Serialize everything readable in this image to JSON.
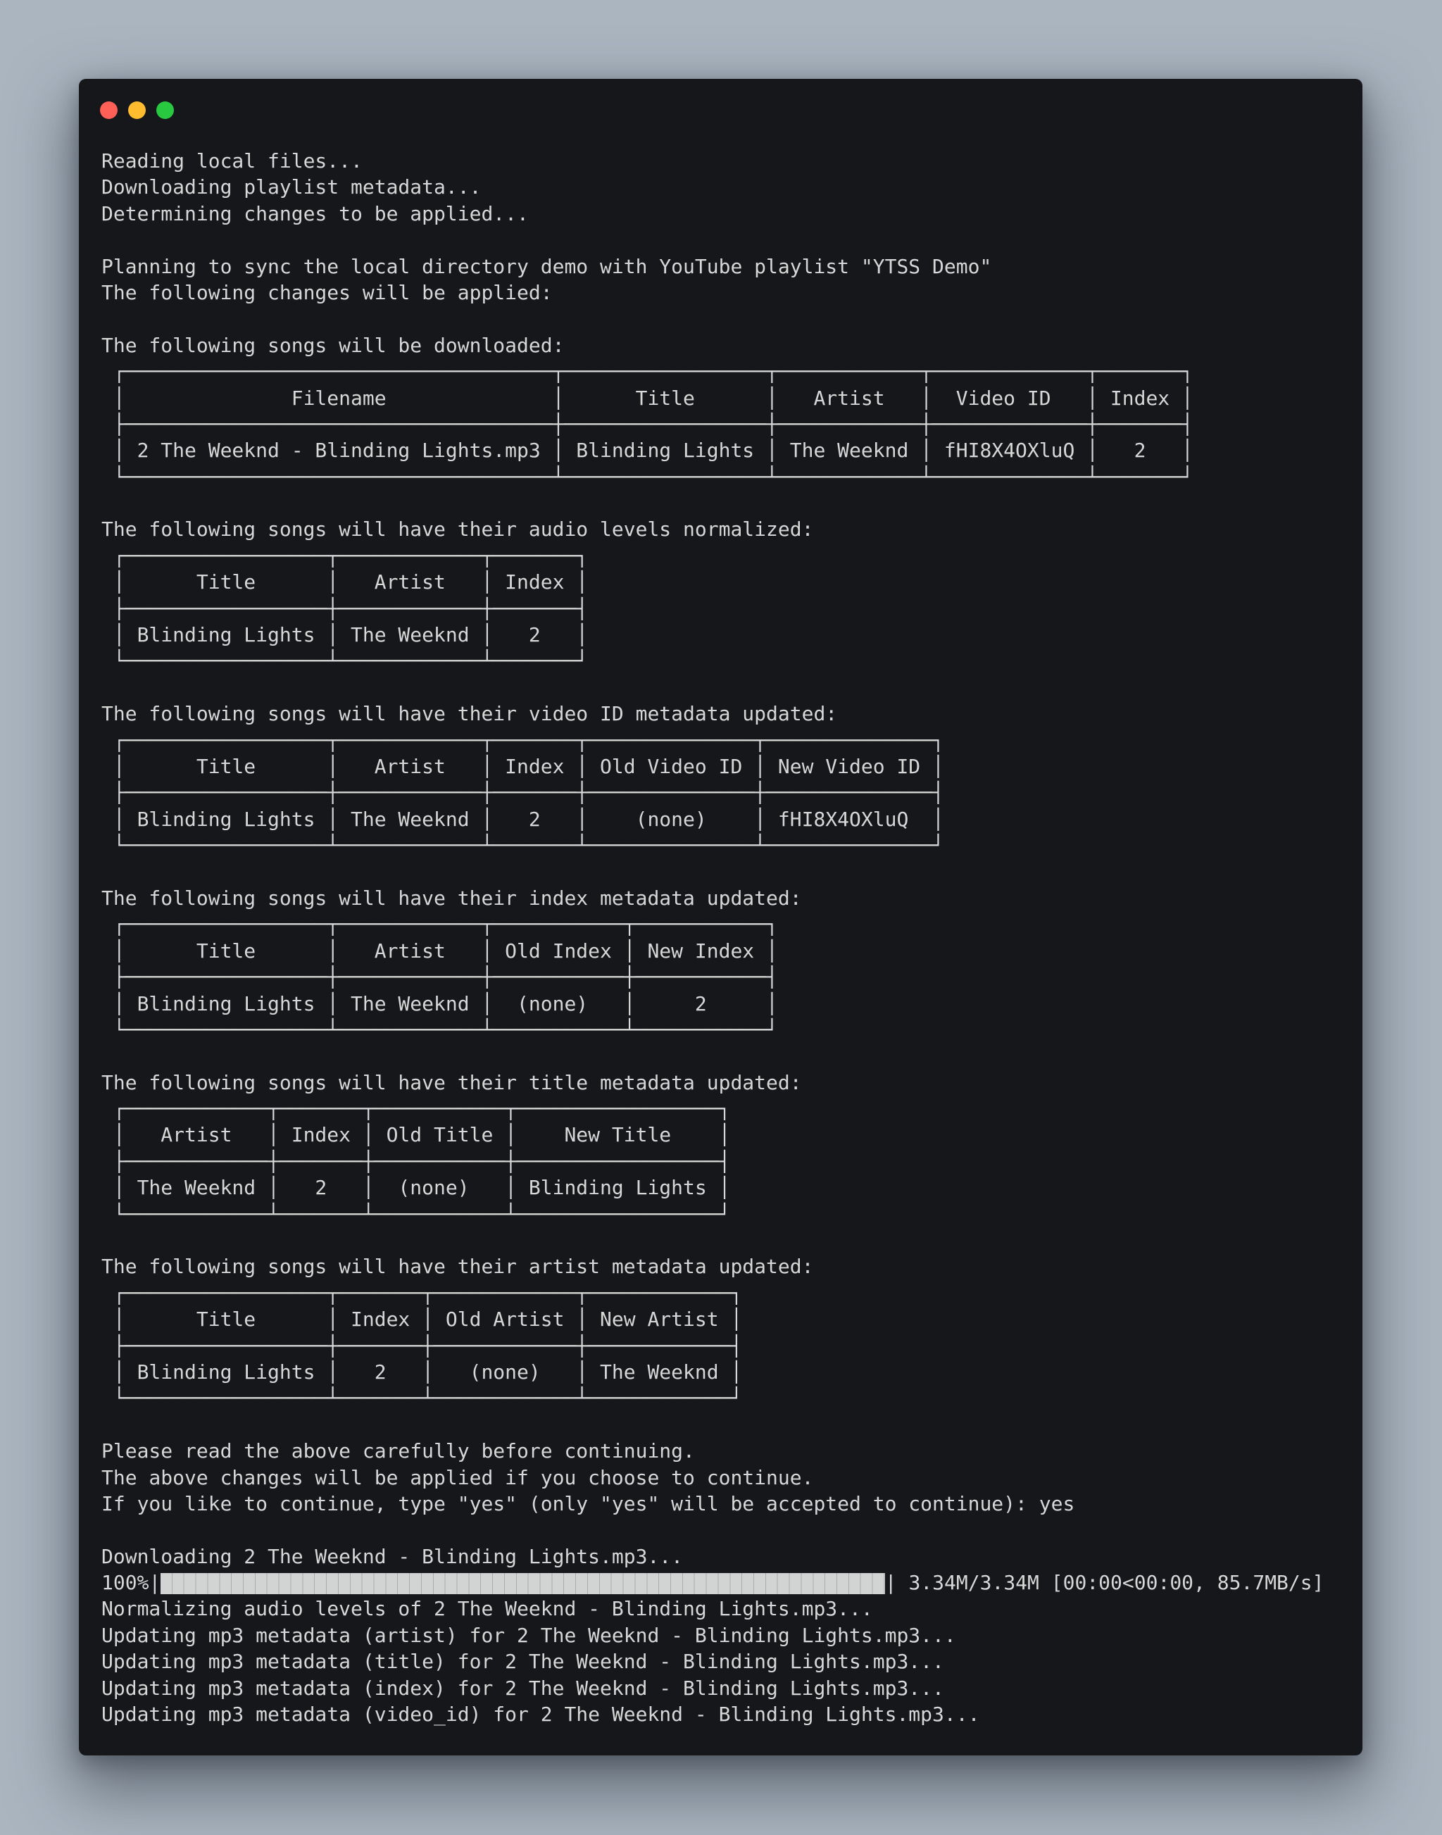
{
  "window": {
    "controls": [
      {
        "name": "close",
        "color": "#fe5f57"
      },
      {
        "name": "minimize",
        "color": "#febc2e"
      },
      {
        "name": "maximize",
        "color": "#28c840"
      }
    ]
  },
  "terminal": {
    "intro_lines": [
      "Reading local files...",
      "Downloading playlist metadata...",
      "Determining changes to be applied...",
      "",
      "Planning to sync the local directory demo with YouTube playlist \"YTSS Demo\"",
      "The following changes will be applied:",
      ""
    ],
    "sections": [
      {
        "heading": "The following songs will be downloaded:",
        "table": {
          "headers": [
            "Filename",
            "Title",
            "Artist",
            "Video ID",
            "Index"
          ],
          "rows": [
            [
              "2 The Weeknd - Blinding Lights.mp3",
              "Blinding Lights",
              "The Weeknd",
              "fHI8X4OXluQ",
              "2"
            ]
          ]
        }
      },
      {
        "heading": "The following songs will have their audio levels normalized:",
        "table": {
          "headers": [
            "Title",
            "Artist",
            "Index"
          ],
          "rows": [
            [
              "Blinding Lights",
              "The Weeknd",
              "2"
            ]
          ]
        }
      },
      {
        "heading": "The following songs will have their video ID metadata updated:",
        "table": {
          "headers": [
            "Title",
            "Artist",
            "Index",
            "Old Video ID",
            "New Video ID"
          ],
          "rows": [
            [
              "Blinding Lights",
              "The Weeknd",
              "2",
              "(none)",
              "fHI8X4OXluQ"
            ]
          ]
        }
      },
      {
        "heading": "The following songs will have their index metadata updated:",
        "table": {
          "headers": [
            "Title",
            "Artist",
            "Old Index",
            "New Index"
          ],
          "rows": [
            [
              "Blinding Lights",
              "The Weeknd",
              "(none)",
              "2"
            ]
          ]
        }
      },
      {
        "heading": "The following songs will have their title metadata updated:",
        "table": {
          "headers": [
            "Artist",
            "Index",
            "Old Title",
            "New Title"
          ],
          "rows": [
            [
              "The Weeknd",
              "2",
              "(none)",
              "Blinding Lights"
            ]
          ]
        }
      },
      {
        "heading": "The following songs will have their artist metadata updated:",
        "table": {
          "headers": [
            "Title",
            "Index",
            "Old Artist",
            "New Artist"
          ],
          "rows": [
            [
              "Blinding Lights",
              "2",
              "(none)",
              "The Weeknd"
            ]
          ]
        }
      }
    ],
    "confirm_lines": [
      "Please read the above carefully before continuing.",
      "The above changes will be applied if you choose to continue.",
      "If you like to continue, type \"yes\" (only \"yes\" will be accepted to continue): yes"
    ],
    "download_line": "Downloading 2 The Weeknd - Blinding Lights.mp3...",
    "progress": {
      "percent_label": "100%",
      "fraction": 1.0,
      "stats": "3.34M/3.34M [00:00<00:00, 85.7MB/s]"
    },
    "post_lines": [
      "Normalizing audio levels of 2 The Weeknd - Blinding Lights.mp3...",
      "Updating mp3 metadata (artist) for 2 The Weeknd - Blinding Lights.mp3...",
      "Updating mp3 metadata (title) for 2 The Weeknd - Blinding Lights.mp3...",
      "Updating mp3 metadata (index) for 2 The Weeknd - Blinding Lights.mp3...",
      "Updating mp3 metadata (video_id) for 2 The Weeknd - Blinding Lights.mp3..."
    ]
  }
}
